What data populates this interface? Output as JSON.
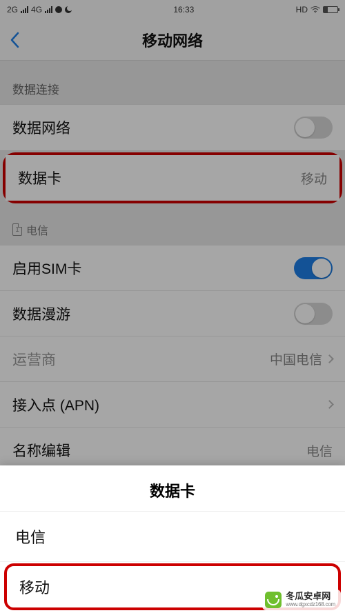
{
  "status_bar": {
    "left_net": "2G",
    "mid_net": "4G",
    "time": "16:33",
    "hd_label": "HD"
  },
  "nav": {
    "title": "移动网络"
  },
  "sections": {
    "data_conn_header": "数据连接",
    "rows": {
      "mobile_data_label": "数据网络",
      "data_card_label": "数据卡",
      "data_card_value": "移动"
    }
  },
  "sim": {
    "slot_number": "1",
    "carrier_header": "电信",
    "enable_sim_label": "启用SIM卡",
    "data_roaming_label": "数据漫游",
    "carrier_label": "运营商",
    "carrier_value": "中国电信",
    "apn_label": "接入点 (APN)",
    "name_edit_label": "名称编辑",
    "name_edit_value": "电信"
  },
  "sheet": {
    "title": "数据卡",
    "option1": "电信",
    "option2": "移动"
  },
  "watermark": {
    "name": "冬瓜安卓网",
    "url": "www.dgxcdz168.com"
  }
}
